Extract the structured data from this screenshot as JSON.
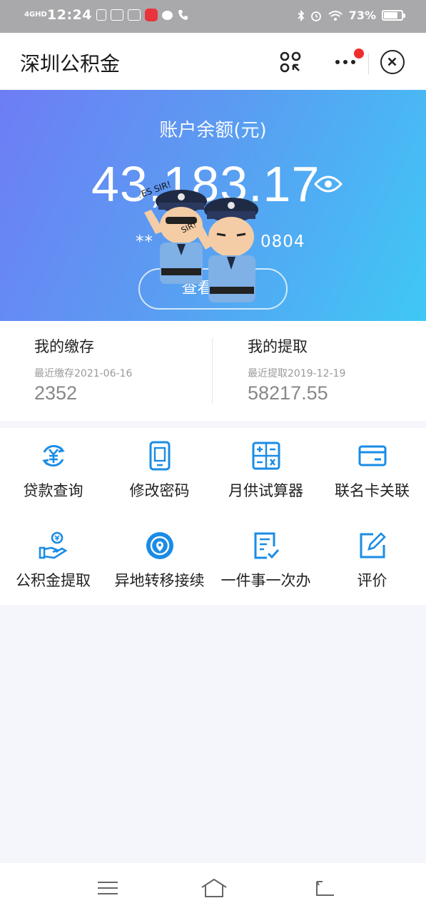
{
  "status_bar": {
    "network": "4GHD",
    "time": "12:24",
    "battery_percent": "73%",
    "battery_level": 0.73,
    "notification_icons": [
      "tuan-icon",
      "image-icon",
      "image-icon",
      "red-app-icon",
      "chat-bubble-icon",
      "phone-icon"
    ]
  },
  "header": {
    "title": "深圳公积金"
  },
  "balance": {
    "label": "账户余额(元)",
    "amount": "43,183.17",
    "account_masked_left": "**",
    "account_masked_right": "0804",
    "detail_button": "查看账户"
  },
  "stats": {
    "deposit": {
      "title": "我的缴存",
      "subtitle": "最近缴存2021-06-16",
      "value": "2352"
    },
    "withdraw": {
      "title": "我的提取",
      "subtitle": "最近提取2019-12-19",
      "value": "58217.55"
    }
  },
  "services": [
    {
      "label": "贷款查询",
      "icon": "yuan-circle-icon"
    },
    {
      "label": "修改密码",
      "icon": "phone-lock-icon"
    },
    {
      "label": "月供试算器",
      "icon": "calculator-icon"
    },
    {
      "label": "联名卡关联",
      "icon": "bank-card-icon"
    },
    {
      "label": "公积金提取",
      "icon": "hand-coin-icon"
    },
    {
      "label": "异地转移接续",
      "icon": "location-transfer-icon"
    },
    {
      "label": "一件事一次办",
      "icon": "checklist-icon"
    },
    {
      "label": "评价",
      "icon": "edit-review-icon"
    }
  ],
  "sticker": {
    "text1": "YES SIR!",
    "text2": "SIR!"
  },
  "colors": {
    "accent": "#1a8ce6",
    "hero_start": "#6e7df5",
    "hero_end": "#3fc8f5"
  }
}
